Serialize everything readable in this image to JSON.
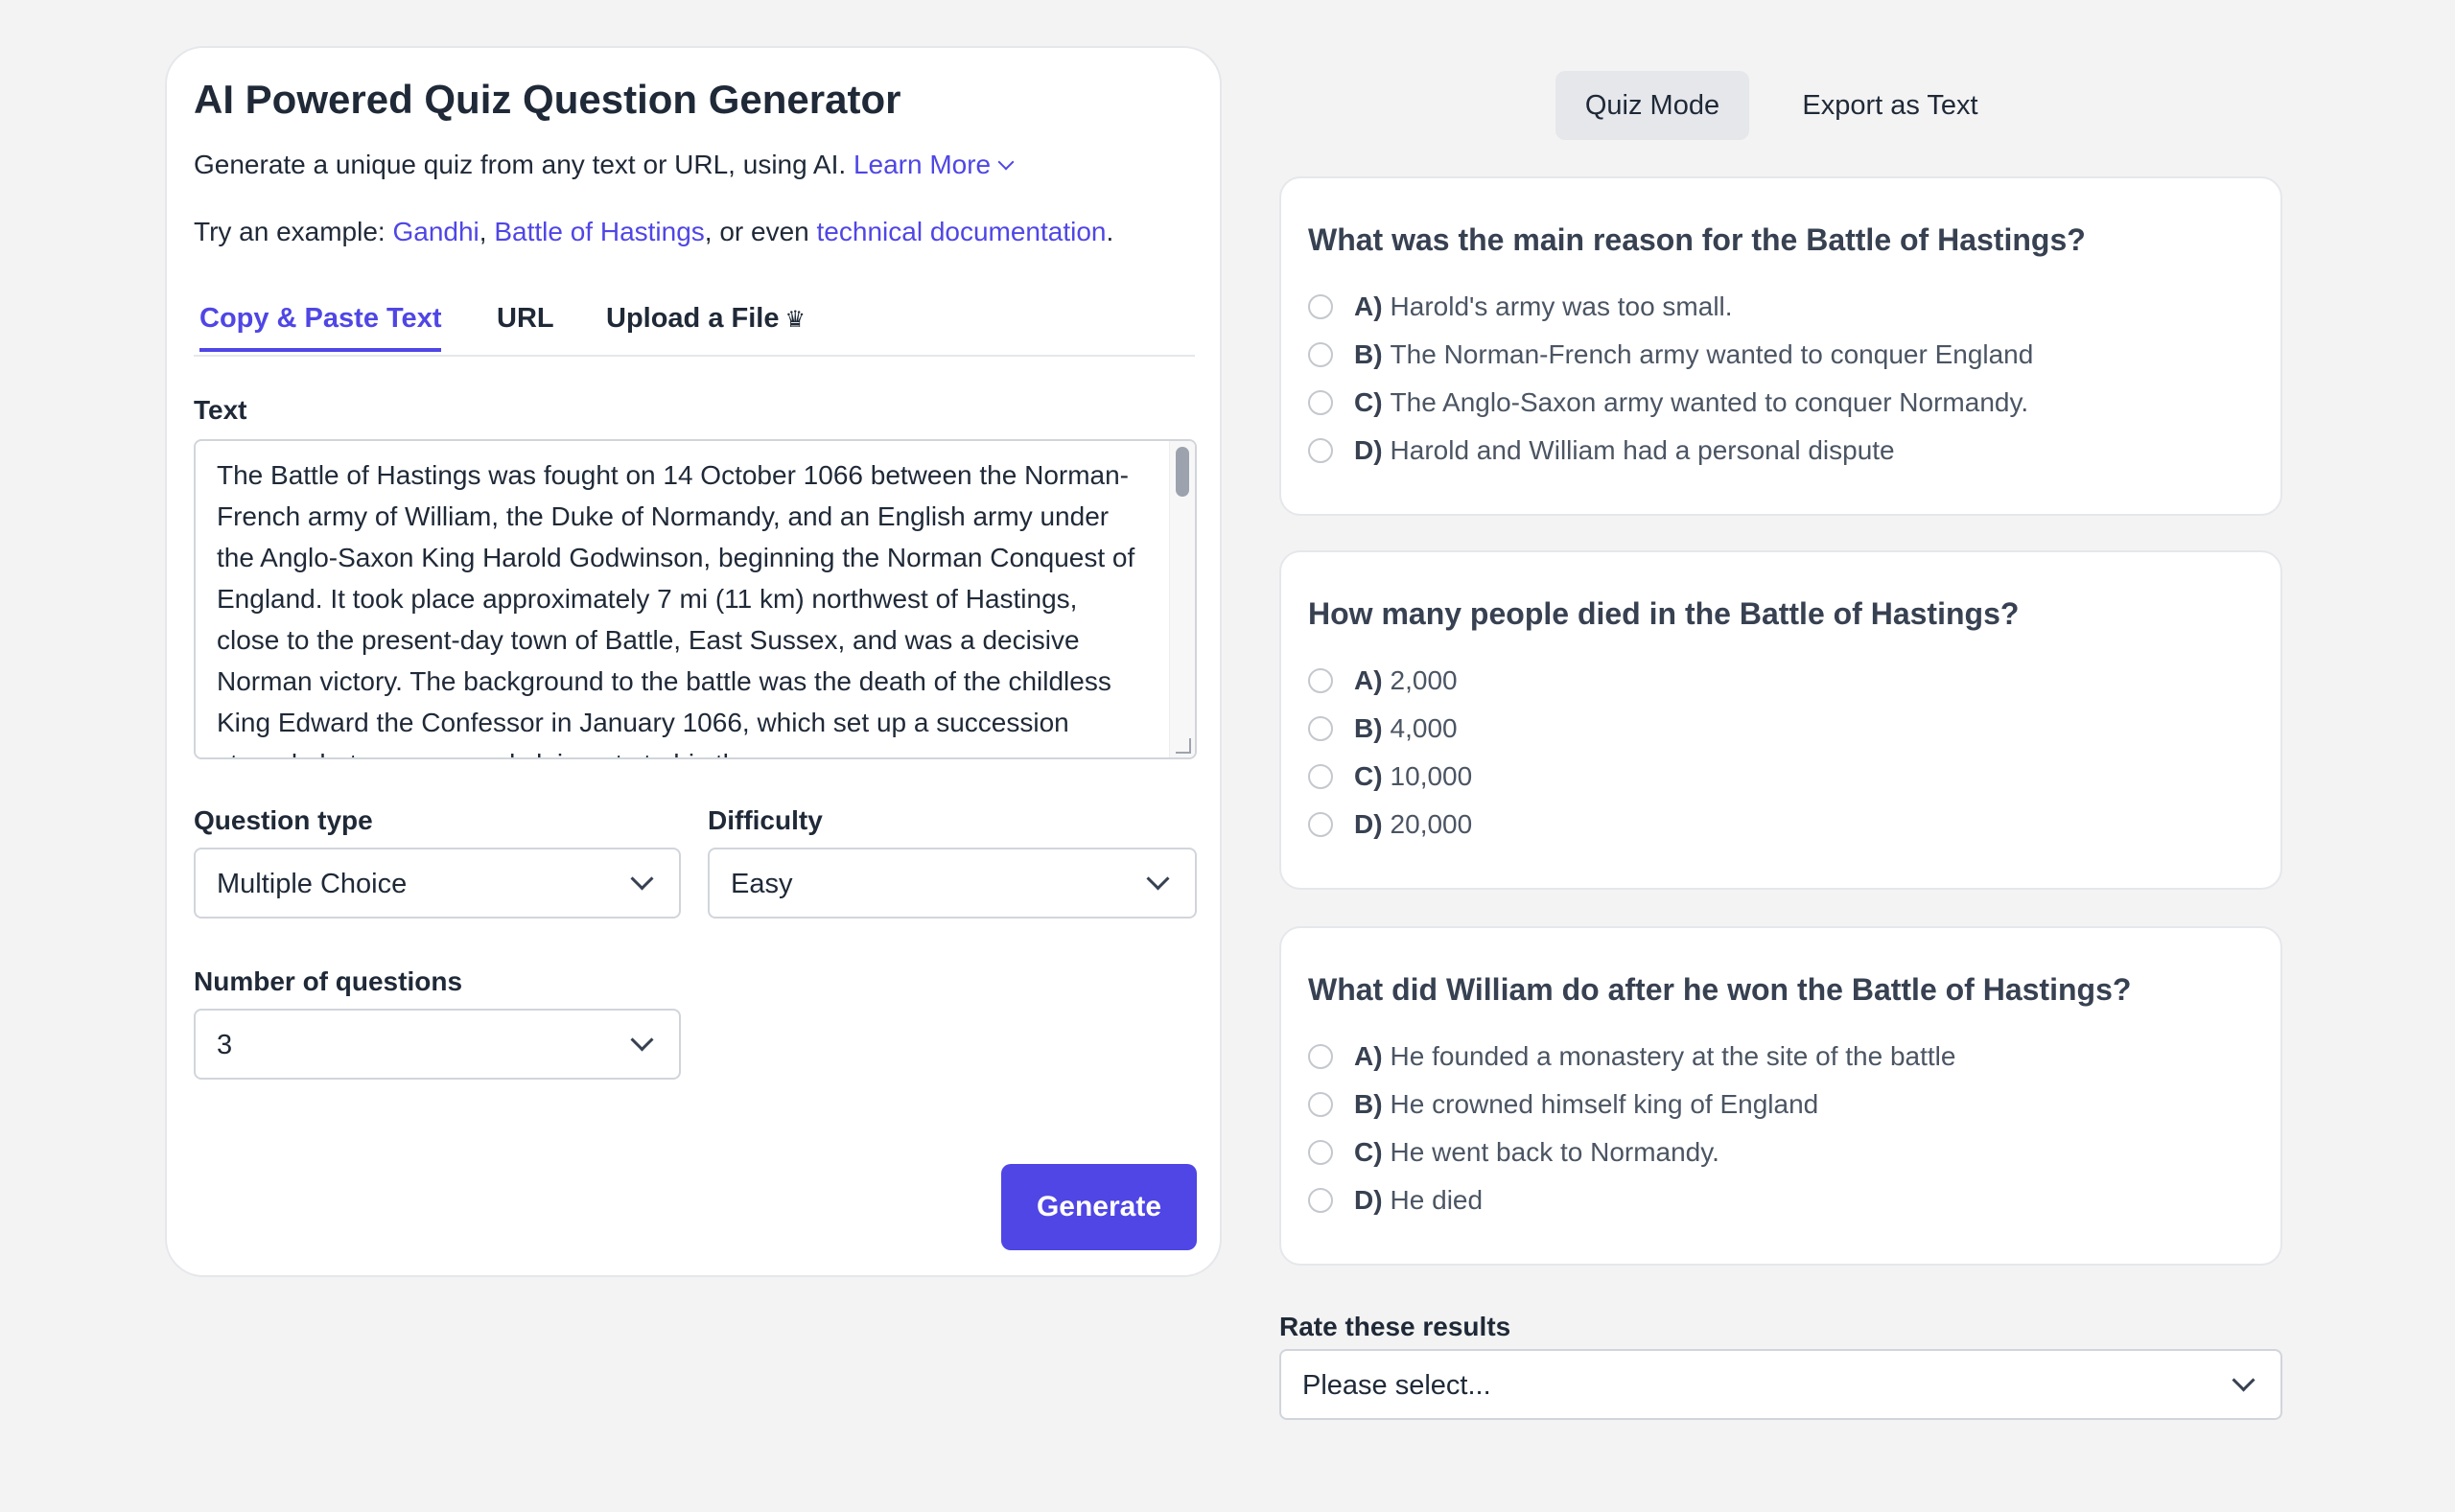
{
  "app": {
    "title": "AI Powered Quiz Question Generator",
    "subtitle": "Generate a unique quiz from any text or URL, using AI.",
    "learn_more": "Learn More",
    "examples": {
      "prefix": "Try an example: ",
      "items": [
        "Gandhi",
        "Battle of Hastings",
        "technical documentation"
      ],
      "sep1": ", ",
      "sep2": ", or even ",
      "suffix": "."
    }
  },
  "tabs": [
    {
      "label": "Copy & Paste Text",
      "active": true
    },
    {
      "label": "URL",
      "active": false
    },
    {
      "label": "Upload a File",
      "active": false,
      "icon": "crown-icon"
    }
  ],
  "text_field": {
    "label": "Text",
    "value": "The Battle of Hastings was fought on 14 October 1066 between the Norman-French army of William, the Duke of Normandy, and an English army under the Anglo-Saxon King Harold Godwinson, beginning the Norman Conquest of England. It took place approximately 7 mi (11 km) northwest of Hastings, close to the present-day town of Battle, East Sussex, and was a decisive Norman victory. The background to the battle was the death of the childless King Edward the Confessor in January 1066, which set up a succession struggle between several claimants to his throne."
  },
  "question_type": {
    "label": "Question type",
    "value": "Multiple Choice"
  },
  "difficulty": {
    "label": "Difficulty",
    "value": "Easy"
  },
  "num_questions": {
    "label": "Number of questions",
    "value": "3"
  },
  "generate_label": "Generate",
  "modes": [
    {
      "label": "Quiz Mode",
      "active": true
    },
    {
      "label": "Export as Text",
      "active": false
    }
  ],
  "questions": [
    {
      "question": "What was the main reason for the Battle of Hastings?",
      "options": [
        {
          "letter": "A)",
          "text": "Harold's army was too small."
        },
        {
          "letter": "B)",
          "text": "The Norman-French army wanted to conquer England"
        },
        {
          "letter": "C)",
          "text": "The Anglo-Saxon army wanted to conquer Normandy."
        },
        {
          "letter": "D)",
          "text": "Harold and William had a personal dispute"
        }
      ]
    },
    {
      "question": "How many people died in the Battle of Hastings?",
      "options": [
        {
          "letter": "A)",
          "text": "2,000"
        },
        {
          "letter": "B)",
          "text": "4,000"
        },
        {
          "letter": "C)",
          "text": "10,000"
        },
        {
          "letter": "D)",
          "text": "20,000"
        }
      ]
    },
    {
      "question": "What did William do after he won the Battle of Hastings?",
      "options": [
        {
          "letter": "A)",
          "text": "He founded a monastery at the site of the battle"
        },
        {
          "letter": "B)",
          "text": "He crowned himself king of England"
        },
        {
          "letter": "C)",
          "text": "He went back to Normandy."
        },
        {
          "letter": "D)",
          "text": "He died"
        }
      ]
    }
  ],
  "rating": {
    "label": "Rate these results",
    "value": "Please select..."
  },
  "colors": {
    "accent": "#4f46e5",
    "background": "#f3f3f3"
  }
}
